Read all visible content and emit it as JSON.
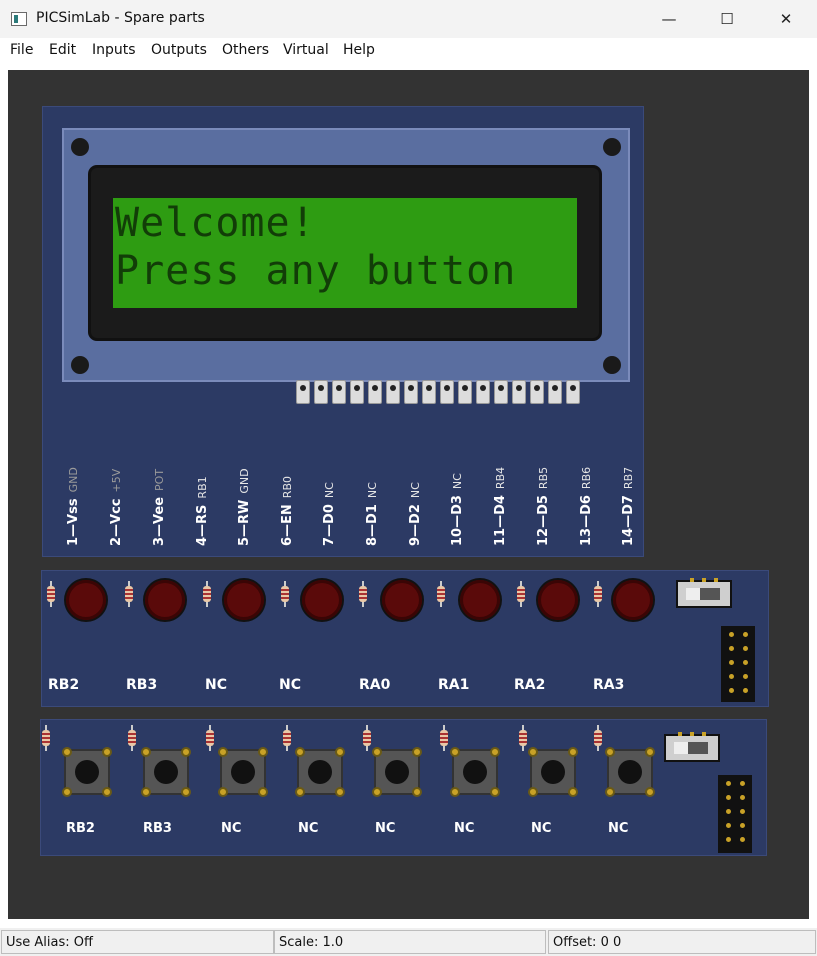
{
  "window": {
    "title": "PICSimLab - Spare parts",
    "minimize_glyph": "—",
    "maximize_glyph": "☐",
    "close_glyph": "✕"
  },
  "menu": [
    "File",
    "Edit",
    "Inputs",
    "Outputs",
    "Others",
    "Virtual",
    "Help"
  ],
  "lcd": {
    "line1": "Welcome!",
    "line2": "Press any button",
    "pins": [
      {
        "label": "1—Vss",
        "signal": "GND",
        "dim": true
      },
      {
        "label": "2—Vcc",
        "signal": "+5V",
        "dim": true
      },
      {
        "label": "3—Vee",
        "signal": "POT",
        "dim": true
      },
      {
        "label": "4—RS",
        "signal": "RB1",
        "dim": false
      },
      {
        "label": "5—RW",
        "signal": "GND",
        "dim": false
      },
      {
        "label": "6—EN",
        "signal": "RB0",
        "dim": false
      },
      {
        "label": "7—D0",
        "signal": "NC",
        "dim": false
      },
      {
        "label": "8—D1",
        "signal": "NC",
        "dim": false
      },
      {
        "label": "9—D2",
        "signal": "NC",
        "dim": false
      },
      {
        "label": "10—D3",
        "signal": "NC",
        "dim": false
      },
      {
        "label": "11—D4",
        "signal": "RB4",
        "dim": false
      },
      {
        "label": "12—D5",
        "signal": "RB5",
        "dim": false
      },
      {
        "label": "13—D6",
        "signal": "RB6",
        "dim": false
      },
      {
        "label": "14—D7",
        "signal": "RB7",
        "dim": false
      }
    ]
  },
  "leds": {
    "labels": [
      "RB2",
      "RB3",
      "NC",
      "NC",
      "RA0",
      "RA1",
      "RA2",
      "RA3"
    ],
    "color": "#5a0a0a"
  },
  "buttons": {
    "labels": [
      "RB2",
      "RB3",
      "NC",
      "NC",
      "NC",
      "NC",
      "NC",
      "NC"
    ]
  },
  "status": {
    "alias": "Use Alias: Off",
    "scale": "Scale: 1.0",
    "offset": "Offset:   0   0"
  },
  "colors": {
    "board": "#2c3a64",
    "lcd_bg": "#2e9c12",
    "lcd_text": "#123d08",
    "workspace": "#333333"
  }
}
